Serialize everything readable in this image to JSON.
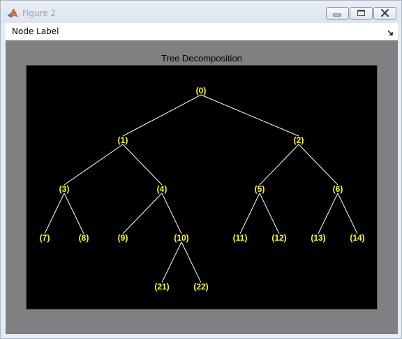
{
  "window": {
    "title": "Figure 2",
    "app_icon": "matlab-icon",
    "controls": [
      "minimize-icon",
      "maximize-icon",
      "close-icon"
    ]
  },
  "toolbar": {
    "node_label_menu": "Node Label",
    "dock_icon": "dock-arrow-icon"
  },
  "figure": {
    "axes_title": "Tree Decomposition",
    "colors": {
      "figure_bg": "#808080",
      "axes_bg": "#000000",
      "edge": "#ffffff",
      "label": "#ffff00"
    }
  },
  "tree": {
    "nodes": [
      {
        "id": "0",
        "label": "(0)"
      },
      {
        "id": "1",
        "label": "(1)",
        "parent": "0"
      },
      {
        "id": "2",
        "label": "(2)",
        "parent": "0"
      },
      {
        "id": "3",
        "label": "(3)",
        "parent": "1"
      },
      {
        "id": "4",
        "label": "(4)",
        "parent": "1"
      },
      {
        "id": "5",
        "label": "(5)",
        "parent": "2"
      },
      {
        "id": "6",
        "label": "(6)",
        "parent": "2"
      },
      {
        "id": "7",
        "label": "(7)",
        "parent": "3"
      },
      {
        "id": "8",
        "label": "(8)",
        "parent": "3"
      },
      {
        "id": "9",
        "label": "(9)",
        "parent": "4"
      },
      {
        "id": "10",
        "label": "(10)",
        "parent": "4"
      },
      {
        "id": "11",
        "label": "(11)",
        "parent": "5"
      },
      {
        "id": "12",
        "label": "(12)",
        "parent": "5"
      },
      {
        "id": "13",
        "label": "(13)",
        "parent": "6"
      },
      {
        "id": "14",
        "label": "(14)",
        "parent": "6"
      },
      {
        "id": "21",
        "label": "(21)",
        "parent": "10"
      },
      {
        "id": "22",
        "label": "(22)",
        "parent": "10"
      }
    ]
  }
}
